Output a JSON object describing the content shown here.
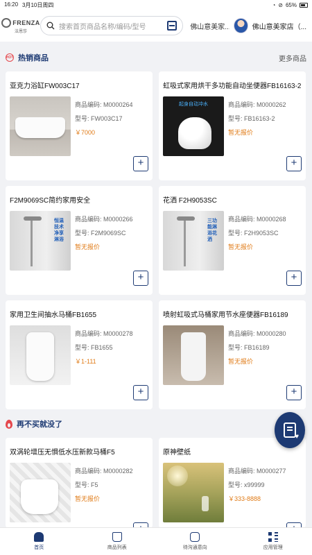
{
  "status_bar": {
    "time": "16:20",
    "date": "3月10日周四",
    "battery": "65%"
  },
  "header": {
    "logo_text": "FRENZA",
    "logo_sub": "法恩莎",
    "search_placeholder": "搜索首页商品名称/编码/型号",
    "location": "佛山意美家...",
    "store_name": "佛山意美家店（..."
  },
  "hot_section": {
    "icon_text": "HOT",
    "title": "热销商品",
    "more": "更多商品"
  },
  "last_section": {
    "title": "再不买就没了"
  },
  "products": [
    {
      "title": "亚克力浴缸FW003C17",
      "code": "商品编码: M0000264",
      "model": "型号: FW003C17",
      "price": "￥7000",
      "image": "bathtub"
    },
    {
      "title": "虹吸式家用烘干多功能自动坐便器FB16163-2",
      "code": "商品编码: M0000262",
      "model": "型号: FB16163-2",
      "price": "暂无报价",
      "image": "smart-toilet",
      "image_text": "起身自动冲水"
    },
    {
      "title": "F2M9069SC简约家用安全",
      "code": "商品编码: M0000266",
      "model": "型号: F2M9069SC",
      "price": "暂无报价",
      "image": "shower",
      "image_text": "恒温技术 净享淋浴"
    },
    {
      "title": "花洒 F2H9053SC",
      "code": "商品编码: M0000268",
      "model": "型号: F2H9053SC",
      "price": "暂无报价",
      "image": "shower",
      "image_text": "三功能淋浴花洒"
    },
    {
      "title": "家用卫生间抽水马桶FB1655",
      "code": "商品编码: M0000278",
      "model": "型号: FB1655",
      "price": "￥1-111",
      "image": "toilet"
    },
    {
      "title": "喷射虹吸式马桶家用节水座便器FB16189",
      "code": "商品编码: M0000280",
      "model": "型号: FB16189",
      "price": "暂无报价",
      "image": "toilet-room"
    },
    {
      "title": "双涡轮增压无惧低水压新款马桶F5",
      "code": "商品编码: M0000282",
      "model": "型号: F5",
      "price": "暂无报价",
      "image": "toilet-tile"
    },
    {
      "title": "原神壁纸",
      "code": "商品编码: M0000277",
      "model": "型号: x99999",
      "price": "￥333-8888",
      "image": "field"
    }
  ],
  "tabs": [
    {
      "label": "首页",
      "icon": "home-icon"
    },
    {
      "label": "商品列表",
      "icon": "bag-icon"
    },
    {
      "label": "待沟通意向",
      "icon": "chat-icon"
    },
    {
      "label": "应用管理",
      "icon": "grid-icon"
    }
  ]
}
